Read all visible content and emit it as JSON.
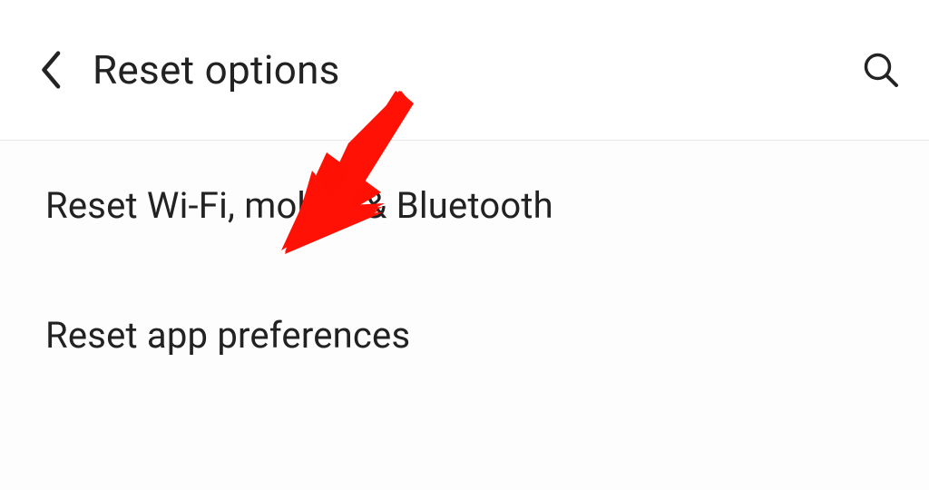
{
  "header": {
    "title": "Reset options"
  },
  "items": [
    {
      "label": "Reset Wi-Fi, mobile & Bluetooth"
    },
    {
      "label": "Reset app preferences"
    }
  ],
  "annotation": {
    "color": "#ff0000",
    "target": "reset-wifi-mobile-bluetooth-item"
  }
}
